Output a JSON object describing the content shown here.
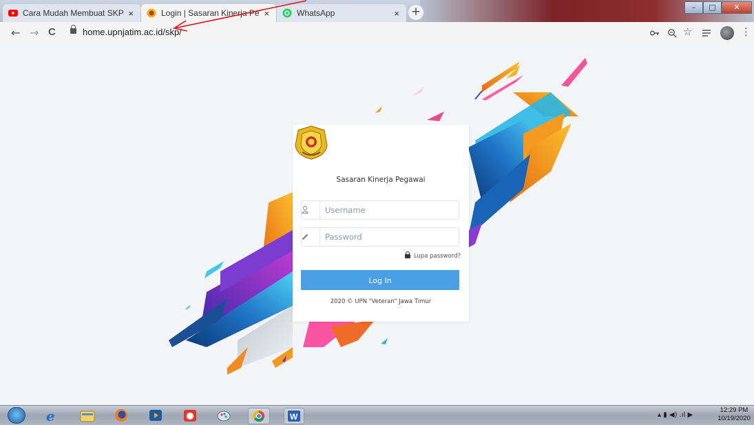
{
  "browser": {
    "tabs": [
      {
        "title": "Cara Mudah Membuat SKP Onlin",
        "close": "×",
        "favicon": "youtube-favicon",
        "active": false
      },
      {
        "title": "Login | Sasaran Kinerja Pegawai |",
        "close": "×",
        "favicon": "upnjatim-favicon",
        "active": true
      },
      {
        "title": "WhatsApp",
        "close": "×",
        "favicon": "whatsapp-favicon",
        "active": false
      }
    ],
    "new_tab": "+",
    "nav": {
      "back": "←",
      "forward": "→",
      "reload": "C"
    },
    "url": "home.upnjatim.ac.id/skp/",
    "toolbar_icons": {
      "key": "key-icon",
      "zoom": "zoom-icon",
      "star": "☆",
      "playlist": "playlist-icon",
      "menu": "⋮"
    }
  },
  "login": {
    "app_title": "Sasaran Kinerja Pegawai",
    "username_placeholder": "Username",
    "password_placeholder": "Password",
    "forgot": "Lupa password?",
    "button": "Log In",
    "footer": "2020 © UPN \"Veteran\" Jawa Timur"
  },
  "taskbar": {
    "time": "12:29 PM",
    "date": "10/19/2020",
    "apps": [
      "internet-explorer",
      "file-explorer",
      "firefox",
      "media-player",
      "app-icon",
      "paint",
      "chrome",
      "word"
    ]
  },
  "colors": {
    "primary_button": "#4a9ee3",
    "annotation_arrow": "#e0141b"
  }
}
